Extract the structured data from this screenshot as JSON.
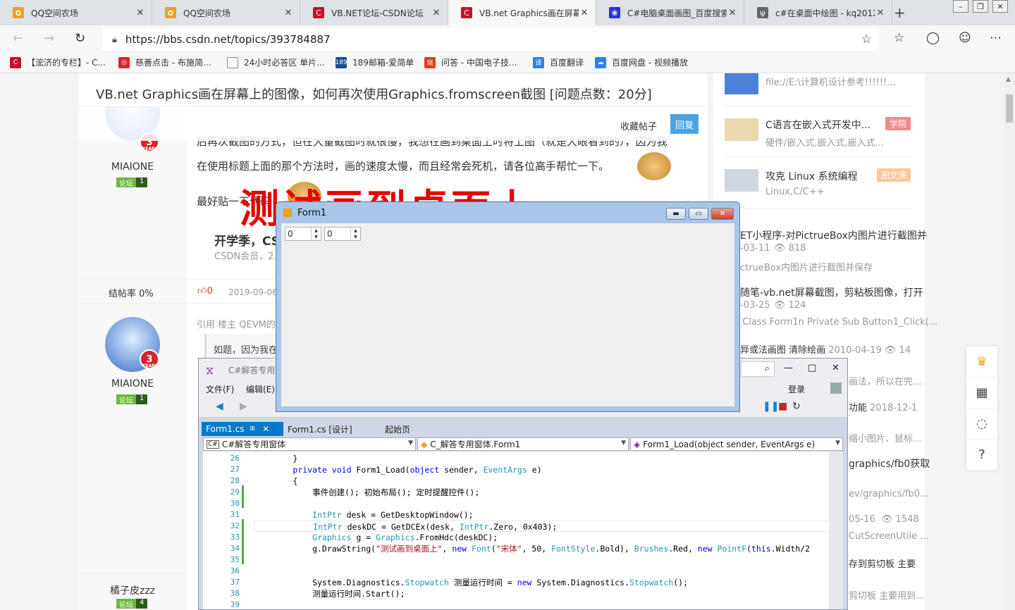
{
  "browser": {
    "tabs": [
      {
        "title": "QQ空间农场",
        "icon": "farm-icon",
        "color": "#f0a020"
      },
      {
        "title": "QQ空间农场",
        "icon": "farm-icon",
        "color": "#f0a020"
      },
      {
        "title": "VB.NET论坛-CSDN论坛",
        "icon": "csdn-icon",
        "color": "#c8102e"
      },
      {
        "title": "VB.net Graphics画在屏幕上",
        "icon": "csdn-icon",
        "color": "#c8102e"
      },
      {
        "title": "C#电脑桌面画图_百度搜索",
        "icon": "baidu-icon",
        "color": "#2932e1"
      },
      {
        "title": "c#在桌面中绘图 - kq2012",
        "icon": "blog-icon",
        "color": "#666666"
      }
    ],
    "url": "https://bbs.csdn.net/topics/393784887",
    "bookmarks": [
      {
        "label": "【浤济的专栏】- C...",
        "color": "#c8102e"
      },
      {
        "label": "慈善点击 - 布施简...",
        "color": "#d9232e"
      },
      {
        "label": "24小时必答区 单片...",
        "color": "#888888"
      },
      {
        "label": "189邮箱-爱简单",
        "color": "#1a4b8c"
      },
      {
        "label": "问答 - 中国电子技...",
        "color": "#e03c1c"
      },
      {
        "label": "百度翻译",
        "color": "#2f80ed"
      },
      {
        "label": "百度网盘 - 视频播放",
        "color": "#2f80ed"
      }
    ]
  },
  "post": {
    "title": "VB.net Graphics画在屏幕上的图像，如何再次使用Graphics.fromscreen截图 [问题点数：20分]",
    "fav_label": "收藏帖子",
    "reply_label": "回复",
    "overlay_text": "测试画到桌面上",
    "body_line1": "后再次截图的方式，但在大量截图时就很慢，我想在画到桌面上时将上图（就是大眼看到的），因为我",
    "body_line2": "在使用标题上面的那个方法时，画的速度太慢，而且经常会死机，请各位高手帮忙一下。",
    "body_line3": "最好贴一下代码",
    "promo_title": "开学季，CS",
    "promo_sub": "CSDN会员，2",
    "rate_label": "结帖率 0%",
    "likes": "0",
    "date": "2019-09-06",
    "quote_label": "引用 楼主 QEVM的",
    "quote_text": "如题，因为我在",
    "user1": {
      "name": "MIAIONE",
      "years": "3",
      "years_label": "YEARS",
      "tag": "论坛",
      "level": "1"
    },
    "user2": {
      "name": "MIAIONE",
      "years": "3",
      "years_label": "YEARS",
      "tag": "论坛",
      "level": "1"
    },
    "user3": {
      "name": "橘子皮zzz",
      "tag": "论坛",
      "level": "4"
    }
  },
  "sidebar": {
    "items": [
      {
        "title": "file://E:\\计算机设计参考!!!!!!..."
      },
      {
        "title": "C语言在嵌入式开发中...",
        "sub": "硬件/嵌入式,嵌入式,嵌入式...",
        "tag": "学院"
      },
      {
        "title": "攻克 Linux 系统编程",
        "sub": "Linux,C/C++",
        "tag": "图文课"
      },
      {
        "title": "ET小程序-对PictrueBox内图片进行截图并",
        "date": "-03-11",
        "views": "818",
        "sub": "ctrueBox内图片进行截图并保存"
      },
      {
        "title": "随笔-vb.net屏幕截图，剪粘板图像，打开",
        "date": "-03-25",
        "views": "124",
        "sub": "c Class Form1n Private Sub Button1_Click(..."
      },
      {
        "title": "异或法画图 清除绘画",
        "date": "2010-04-19",
        "views": "14",
        "sub": "画法，所以在完..."
      },
      {
        "title": "功能",
        "date": "2018-12-1",
        "sub": "缩小图片、鼠标..."
      },
      {
        "title": "graphics/fb0获取",
        "sub": "ev/graphics/fb0..."
      },
      {
        "title": "",
        "date": "05-16",
        "views": "1548",
        "sub": "CutScreenUtile ..."
      },
      {
        "title": "存到剪切板 主要",
        "sub": "剪切板 主要用到..."
      }
    ]
  },
  "vs": {
    "title": "C#解答专用",
    "menu": [
      "文件(F)",
      "编辑(E)"
    ],
    "login": "登录",
    "tabs": [
      "Form1.cs",
      "Form1.cs [设计]",
      "起始页"
    ],
    "combo1": "C#解答专用窗体",
    "combo2": "C_解答专用窗体.Form1",
    "combo3": "Form1_Load(object sender, EventArgs e)",
    "line_numbers": [
      "26",
      "27",
      "28",
      "29",
      "30",
      "31",
      "32",
      "33",
      "34",
      "35",
      "36",
      "37",
      "38",
      "39"
    ]
  },
  "form1": {
    "title": "Form1",
    "spinner1": "0",
    "spinner2": "0"
  }
}
